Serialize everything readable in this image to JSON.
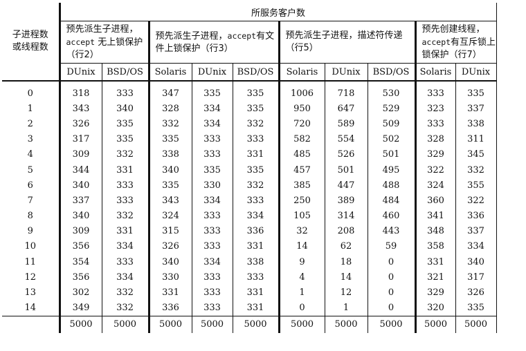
{
  "table": {
    "group_header": "所服务客户数",
    "row_header": [
      "子进程数",
      "或线程数"
    ],
    "groups": [
      {
        "desc_parts": [
          "预先派生子进程，",
          "accept",
          "无上锁保护（行2）"
        ],
        "cols": [
          "DUnix",
          "BSD/OS"
        ]
      },
      {
        "desc_parts": [
          "预先派生子进程，",
          "accept",
          "有文件上锁保护（行3）"
        ],
        "cols": [
          "Solaris",
          "DUnix",
          "BSD/OS"
        ]
      },
      {
        "desc_parts": [
          "预先派生子进程，描述符传递（行5）",
          "",
          ""
        ],
        "cols": [
          "Solaris",
          "DUnix",
          "BSD/OS"
        ]
      },
      {
        "desc_parts": [
          "预先创建线程，",
          "accept",
          "有互斥锁上锁保护（行7）"
        ],
        "cols": [
          "Solaris",
          "DUnix"
        ]
      }
    ],
    "rows": [
      [
        "0",
        "318",
        "333",
        "347",
        "335",
        "335",
        "1006",
        "718",
        "530",
        "333",
        "335"
      ],
      [
        "1",
        "343",
        "340",
        "328",
        "334",
        "335",
        "950",
        "647",
        "529",
        "323",
        "337"
      ],
      [
        "2",
        "326",
        "335",
        "332",
        "334",
        "332",
        "720",
        "589",
        "509",
        "333",
        "338"
      ],
      [
        "3",
        "317",
        "335",
        "335",
        "333",
        "333",
        "582",
        "554",
        "502",
        "328",
        "311"
      ],
      [
        "4",
        "309",
        "332",
        "338",
        "333",
        "331",
        "485",
        "526",
        "501",
        "329",
        "345"
      ],
      [
        "5",
        "344",
        "331",
        "340",
        "335",
        "335",
        "457",
        "501",
        "495",
        "322",
        "332"
      ],
      [
        "6",
        "340",
        "333",
        "335",
        "330",
        "332",
        "385",
        "447",
        "488",
        "324",
        "355"
      ],
      [
        "7",
        "337",
        "333",
        "343",
        "334",
        "333",
        "250",
        "389",
        "484",
        "360",
        "322"
      ],
      [
        "8",
        "340",
        "332",
        "324",
        "333",
        "334",
        "105",
        "314",
        "460",
        "341",
        "336"
      ],
      [
        "9",
        "309",
        "331",
        "315",
        "333",
        "336",
        "32",
        "208",
        "443",
        "348",
        "337"
      ],
      [
        "10",
        "356",
        "334",
        "326",
        "333",
        "331",
        "14",
        "62",
        "59",
        "358",
        "334"
      ],
      [
        "11",
        "354",
        "333",
        "340",
        "334",
        "338",
        "9",
        "18",
        "0",
        "331",
        "340"
      ],
      [
        "12",
        "356",
        "334",
        "330",
        "333",
        "333",
        "4",
        "14",
        "0",
        "321",
        "317"
      ],
      [
        "13",
        "302",
        "332",
        "331",
        "333",
        "331",
        "1",
        "12",
        "0",
        "329",
        "326"
      ],
      [
        "14",
        "349",
        "332",
        "336",
        "333",
        "331",
        "0",
        "1",
        "0",
        "320",
        "335"
      ]
    ],
    "totals": [
      "5000",
      "5000",
      "5000",
      "5000",
      "5000",
      "5000",
      "5000",
      "5000",
      "5000",
      "5000"
    ]
  }
}
